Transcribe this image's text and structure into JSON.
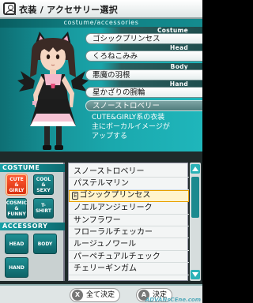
{
  "top": {
    "title": "衣装 / アクセサリー選択",
    "subtitle": "costume/accessories",
    "categories": {
      "costume": {
        "label": "Costume",
        "value": "ゴシックプリンセス"
      },
      "head": {
        "label": "Head",
        "value": "くろねこみみ"
      },
      "body": {
        "label": "Body",
        "value": "悪魔の羽根"
      },
      "hand": {
        "label": "Hand",
        "value": "星かざりの腕輪"
      }
    },
    "highlight": "スノーストロベリー",
    "description_lines": [
      "CUTE&GIRLY系の衣装",
      "主にボーカルイメージが",
      "アップする"
    ]
  },
  "sidebar": {
    "costume_label": "COSTUME",
    "accessory_label": "ACCESSORY",
    "costume_tiles": [
      {
        "line1": "CUTE &",
        "line2": "GIRLY",
        "selected": true
      },
      {
        "line1": "COOL &",
        "line2": "SEXY",
        "selected": false
      },
      {
        "line1": "COSMIC &",
        "line2": "FUNNY",
        "selected": false
      },
      {
        "line1": "T-SHIRT",
        "line2": "",
        "selected": false
      }
    ],
    "accessory_tiles": [
      "HEAD",
      "BODY",
      "HAND"
    ]
  },
  "list": {
    "items": [
      "スノーストロベリー",
      "パステルマリン",
      "ゴシックプリンセス",
      "ノエルアンジェリーク",
      "サンフラワー",
      "フローラルチェッカー",
      "ルージュノワール",
      "パーペチュアルチェック",
      "チェリーギンガム"
    ],
    "selected_index": 2,
    "equipped_mark": "E"
  },
  "footer": {
    "cancel_icon": "X",
    "cancel_label": "全て決定",
    "confirm_icon": "A",
    "confirm_label": "決定",
    "watermark": "ADVANsCEne.com"
  },
  "colors": {
    "accent_teal": "#1aa8ad",
    "selected_orange": "#d8300f",
    "highlight_gold": "#e8a000"
  }
}
